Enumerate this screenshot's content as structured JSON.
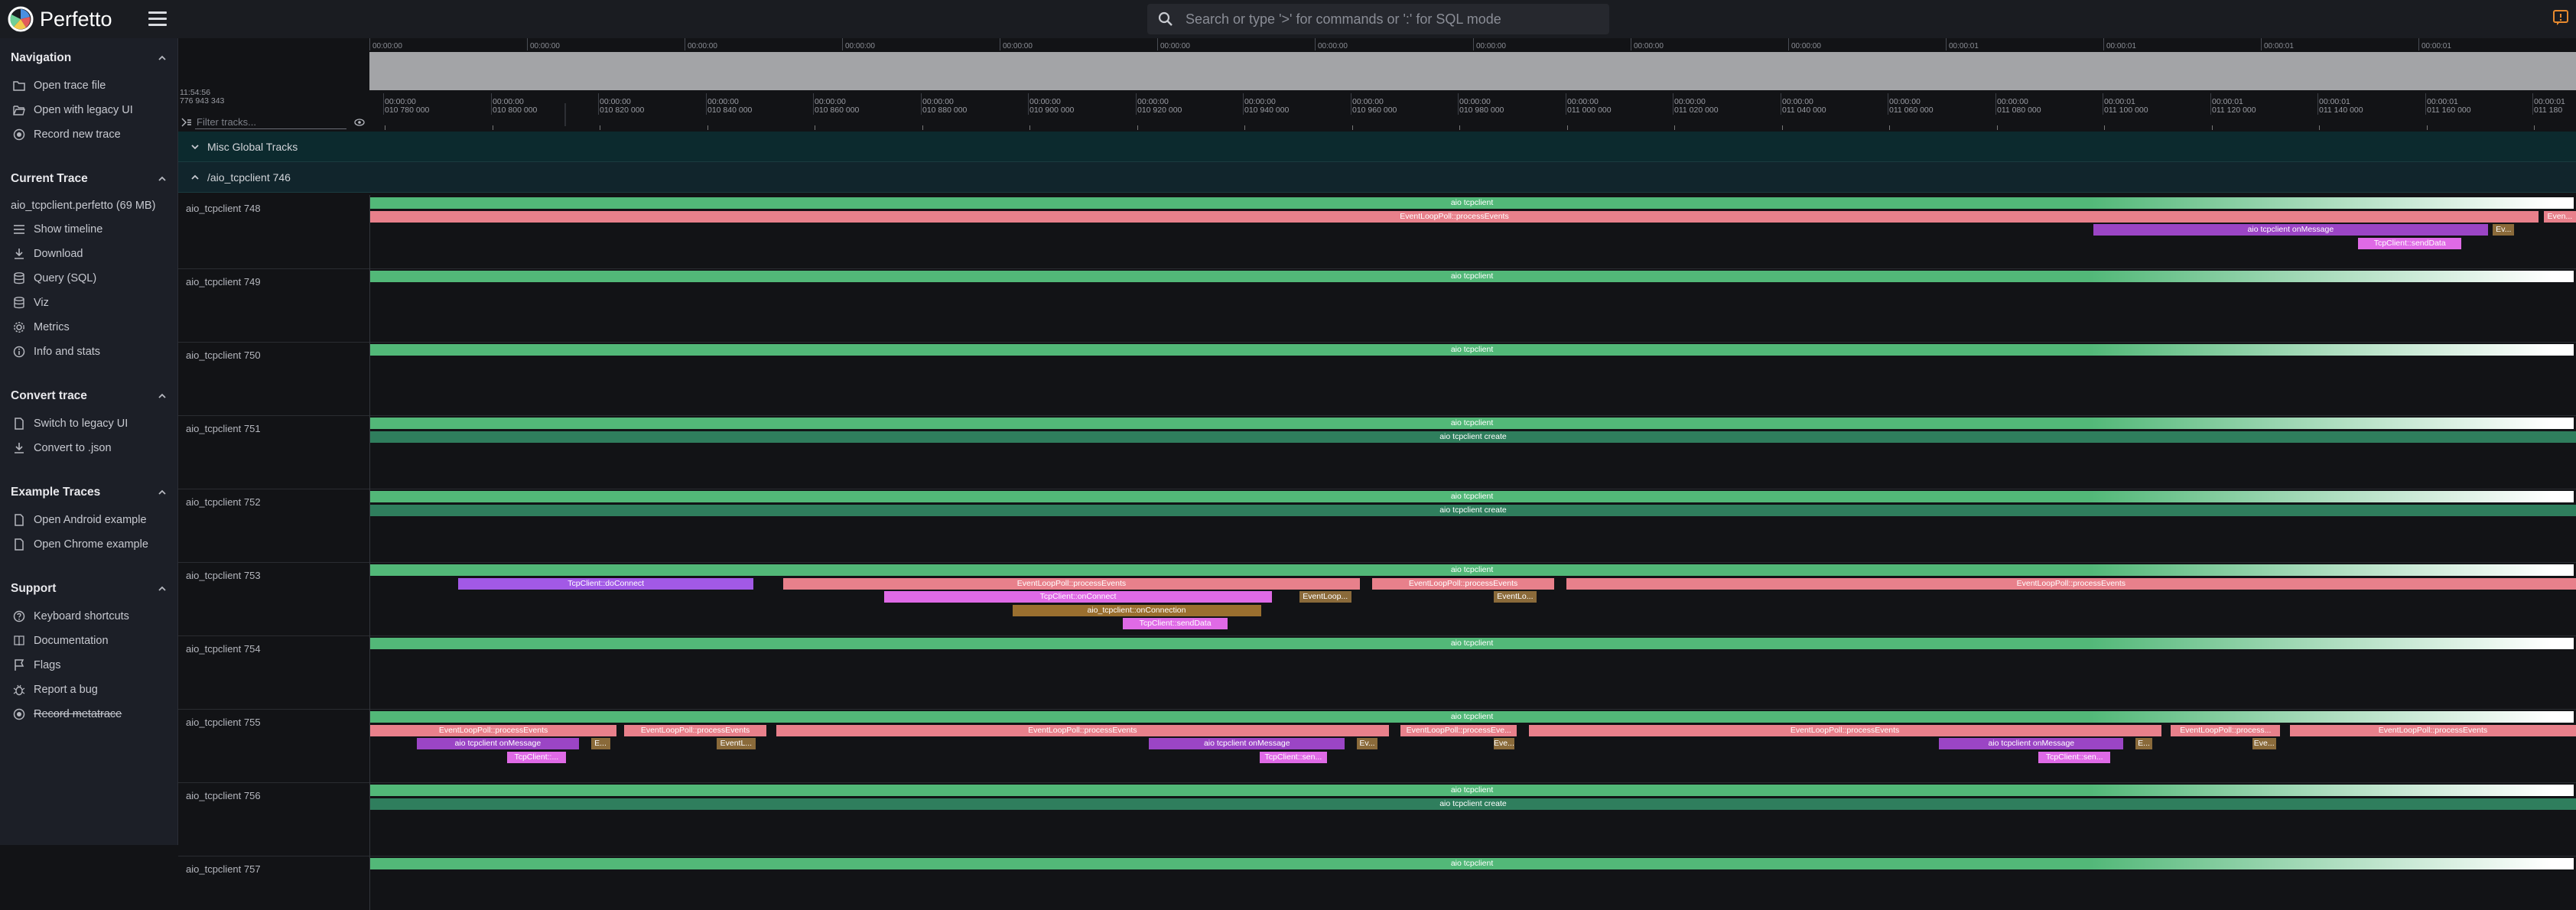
{
  "app": {
    "title": "Perfetto"
  },
  "search": {
    "placeholder": "Search or type '>' for commands or ':' for SQL mode"
  },
  "sidebar": {
    "sections": [
      {
        "title": "Navigation",
        "items": [
          {
            "label": "Open trace file",
            "icon": "folder-icon"
          },
          {
            "label": "Open with legacy UI",
            "icon": "folder-open-icon"
          },
          {
            "label": "Record new trace",
            "icon": "record-icon"
          }
        ]
      },
      {
        "title": "Current Trace",
        "trace_name": "aio_tcpclient.perfetto (69 MB)",
        "items": [
          {
            "label": "Show timeline",
            "icon": "list-icon"
          },
          {
            "label": "Download",
            "icon": "download-icon"
          },
          {
            "label": "Query (SQL)",
            "icon": "database-icon"
          },
          {
            "label": "Viz",
            "icon": "database-icon"
          },
          {
            "label": "Metrics",
            "icon": "gear-icon"
          },
          {
            "label": "Info and stats",
            "icon": "info-icon"
          }
        ]
      },
      {
        "title": "Convert trace",
        "items": [
          {
            "label": "Switch to legacy UI",
            "icon": "file-icon"
          },
          {
            "label": "Convert to .json",
            "icon": "download-icon"
          }
        ]
      },
      {
        "title": "Example Traces",
        "items": [
          {
            "label": "Open Android example",
            "icon": "file-icon"
          },
          {
            "label": "Open Chrome example",
            "icon": "file-icon"
          }
        ]
      },
      {
        "title": "Support",
        "items": [
          {
            "label": "Keyboard shortcuts",
            "icon": "keyboard-icon"
          },
          {
            "label": "Documentation",
            "icon": "book-icon"
          },
          {
            "label": "Flags",
            "icon": "flag-icon"
          },
          {
            "label": "Report a bug",
            "icon": "bug-icon"
          },
          {
            "label": "Record metatrace",
            "icon": "record-icon",
            "strikethrough": true
          }
        ]
      }
    ]
  },
  "timeline": {
    "origin": [
      "11:54:56",
      "776 943 343"
    ],
    "overview_ticks": [
      "00:00:00",
      "00:00:00",
      "00:00:00",
      "00:00:00",
      "00:00:00",
      "00:00:00",
      "00:00:00",
      "00:00:00",
      "00:00:00",
      "00:00:00",
      "00:00:01",
      "00:00:01",
      "00:00:01",
      "00:00:01"
    ],
    "ruler_ticks": [
      [
        "00:00:00",
        "010 780 000"
      ],
      [
        "00:00:00",
        "010 800 000"
      ],
      [
        "00:00:00",
        "010 820 000"
      ],
      [
        "00:00:00",
        "010 840 000"
      ],
      [
        "00:00:00",
        "010 860 000"
      ],
      [
        "00:00:00",
        "010 880 000"
      ],
      [
        "00:00:00",
        "010 900 000"
      ],
      [
        "00:00:00",
        "010 920 000"
      ],
      [
        "00:00:00",
        "010 940 000"
      ],
      [
        "00:00:00",
        "010 960 000"
      ],
      [
        "00:00:00",
        "010 980 000"
      ],
      [
        "00:00:00",
        "011 000 000"
      ],
      [
        "00:00:00",
        "011 020 000"
      ],
      [
        "00:00:00",
        "011 040 000"
      ],
      [
        "00:00:00",
        "011 060 000"
      ],
      [
        "00:00:00",
        "011 080 000"
      ],
      [
        "00:00:01",
        "011 100 000"
      ],
      [
        "00:00:01",
        "011 120 000"
      ],
      [
        "00:00:01",
        "011 140 000"
      ],
      [
        "00:00:01",
        "011 160 000"
      ],
      [
        "00:00:01",
        "011 180"
      ]
    ],
    "filter_placeholder": "Filter tracks...",
    "groups": {
      "misc": "Misc Global Tracks",
      "process": "/aio_tcpclient 746"
    }
  },
  "colors": {
    "green": "#52b878",
    "darkgreen": "#2f7e5d",
    "pink": "#e8808b",
    "purple": "#9b45c5",
    "magenta": "#df6ae6",
    "olive": "#9a6f2f",
    "lavender": "#a259e6",
    "brown": "#8a6a3a"
  },
  "tracks": [
    {
      "name": "aio_tcpclient 748",
      "slices": [
        {
          "s": 0.0,
          "e": 0.999,
          "d": 0,
          "c": "green",
          "t": "aio tcpclient",
          "fade": true
        },
        {
          "s": 0.0,
          "e": 0.983,
          "d": 1,
          "c": "pink",
          "t": "EventLoopPoll::processEvents"
        },
        {
          "s": 0.985,
          "e": 1.0,
          "d": 1,
          "c": "pink",
          "t": "Even..."
        },
        {
          "s": 0.781,
          "e": 0.96,
          "d": 2,
          "c": "purple",
          "t": "aio tcpclient onMessage"
        },
        {
          "s": 0.962,
          "e": 0.972,
          "d": 2,
          "c": "brown",
          "t": "Ev..."
        },
        {
          "s": 0.901,
          "e": 0.948,
          "d": 3,
          "c": "magenta",
          "t": "TcpClient::sendData"
        }
      ]
    },
    {
      "name": "aio_tcpclient 749",
      "slices": [
        {
          "s": 0.0,
          "e": 0.999,
          "d": 0,
          "c": "green",
          "t": "aio tcpclient",
          "fade": true
        }
      ]
    },
    {
      "name": "aio_tcpclient 750",
      "slices": [
        {
          "s": 0.0,
          "e": 0.999,
          "d": 0,
          "c": "green",
          "t": "aio tcpclient",
          "fade": true
        }
      ]
    },
    {
      "name": "aio_tcpclient 751",
      "slices": [
        {
          "s": 0.0,
          "e": 0.999,
          "d": 0,
          "c": "green",
          "t": "aio tcpclient",
          "fade": true
        },
        {
          "s": 0.0,
          "e": 1.0,
          "d": 1,
          "c": "darkgreen",
          "t": "aio tcpclient create"
        }
      ]
    },
    {
      "name": "aio_tcpclient 752",
      "slices": [
        {
          "s": 0.0,
          "e": 0.999,
          "d": 0,
          "c": "green",
          "t": "aio tcpclient",
          "fade": true
        },
        {
          "s": 0.0,
          "e": 1.0,
          "d": 1,
          "c": "darkgreen",
          "t": "aio tcpclient create"
        }
      ]
    },
    {
      "name": "aio_tcpclient 753",
      "slices": [
        {
          "s": 0.0,
          "e": 0.999,
          "d": 0,
          "c": "green",
          "t": "aio tcpclient",
          "fade": true
        },
        {
          "s": 0.04,
          "e": 0.174,
          "d": 1,
          "c": "lavender",
          "t": "TcpClient::doConnect"
        },
        {
          "s": 0.187,
          "e": 0.449,
          "d": 1,
          "c": "pink",
          "t": "EventLoopPoll::processEvents"
        },
        {
          "s": 0.454,
          "e": 0.537,
          "d": 1,
          "c": "pink",
          "t": "EventLoopPoll::processEvents"
        },
        {
          "s": 0.542,
          "e": 1.0,
          "d": 1,
          "c": "pink",
          "t": "EventLoopPoll::processEvents"
        },
        {
          "s": 0.233,
          "e": 0.409,
          "d": 2,
          "c": "magenta",
          "t": "TcpClient::onConnect"
        },
        {
          "s": 0.421,
          "e": 0.445,
          "d": 2,
          "c": "brown",
          "t": "EventLoop..."
        },
        {
          "s": 0.509,
          "e": 0.529,
          "d": 2,
          "c": "brown",
          "t": "EventLo..."
        },
        {
          "s": 0.291,
          "e": 0.404,
          "d": 3,
          "c": "olive",
          "t": "aio_tcpclient::onConnection"
        },
        {
          "s": 0.341,
          "e": 0.389,
          "d": 4,
          "c": "magenta",
          "t": "TcpClient::sendData"
        }
      ]
    },
    {
      "name": "aio_tcpclient 754",
      "slices": [
        {
          "s": 0.0,
          "e": 0.999,
          "d": 0,
          "c": "green",
          "t": "aio tcpclient",
          "fade": true
        }
      ]
    },
    {
      "name": "aio_tcpclient 755",
      "slices": [
        {
          "s": 0.0,
          "e": 0.999,
          "d": 0,
          "c": "green",
          "t": "aio tcpclient",
          "fade": true
        },
        {
          "s": 0.0,
          "e": 0.112,
          "d": 1,
          "c": "pink",
          "t": "EventLoopPoll::processEvents"
        },
        {
          "s": 0.115,
          "e": 0.18,
          "d": 1,
          "c": "pink",
          "t": "EventLoopPoll::processEvents"
        },
        {
          "s": 0.184,
          "e": 0.462,
          "d": 1,
          "c": "pink",
          "t": "EventLoopPoll::processEvents"
        },
        {
          "s": 0.467,
          "e": 0.52,
          "d": 1,
          "c": "pink",
          "t": "EventLoopPoll::processEve..."
        },
        {
          "s": 0.525,
          "e": 0.812,
          "d": 1,
          "c": "pink",
          "t": "EventLoopPoll::processEvents"
        },
        {
          "s": 0.816,
          "e": 0.866,
          "d": 1,
          "c": "pink",
          "t": "EventLoopPoll::process..."
        },
        {
          "s": 0.87,
          "e": 1.0,
          "d": 1,
          "c": "pink",
          "t": "EventLoopPoll::processEvents"
        },
        {
          "s": 0.021,
          "e": 0.095,
          "d": 2,
          "c": "purple",
          "t": "aio tcpclient onMessage"
        },
        {
          "s": 0.1,
          "e": 0.109,
          "d": 2,
          "c": "brown",
          "t": "E..."
        },
        {
          "s": 0.157,
          "e": 0.175,
          "d": 2,
          "c": "brown",
          "t": "EventL..."
        },
        {
          "s": 0.353,
          "e": 0.442,
          "d": 2,
          "c": "purple",
          "t": "aio tcpclient onMessage"
        },
        {
          "s": 0.447,
          "e": 0.457,
          "d": 2,
          "c": "brown",
          "t": "Ev..."
        },
        {
          "s": 0.509,
          "e": 0.519,
          "d": 2,
          "c": "brown",
          "t": "Eve..."
        },
        {
          "s": 0.711,
          "e": 0.795,
          "d": 2,
          "c": "purple",
          "t": "aio tcpclient onMessage"
        },
        {
          "s": 0.8,
          "e": 0.808,
          "d": 2,
          "c": "brown",
          "t": "E..."
        },
        {
          "s": 0.853,
          "e": 0.864,
          "d": 2,
          "c": "brown",
          "t": "Eve..."
        },
        {
          "s": 0.062,
          "e": 0.089,
          "d": 3,
          "c": "magenta",
          "t": "TcpClient::..."
        },
        {
          "s": 0.403,
          "e": 0.434,
          "d": 3,
          "c": "magenta",
          "t": "TcpClient::sen..."
        },
        {
          "s": 0.756,
          "e": 0.789,
          "d": 3,
          "c": "magenta",
          "t": "TcpClient::sen..."
        }
      ]
    },
    {
      "name": "aio_tcpclient 756",
      "slices": [
        {
          "s": 0.0,
          "e": 0.999,
          "d": 0,
          "c": "green",
          "t": "aio tcpclient",
          "fade": true
        },
        {
          "s": 0.0,
          "e": 1.0,
          "d": 1,
          "c": "darkgreen",
          "t": "aio tcpclient create"
        }
      ]
    },
    {
      "name": "aio_tcpclient 757",
      "slices": [
        {
          "s": 0.0,
          "e": 0.999,
          "d": 0,
          "c": "green",
          "t": "aio tcpclient",
          "fade": true
        }
      ]
    }
  ]
}
